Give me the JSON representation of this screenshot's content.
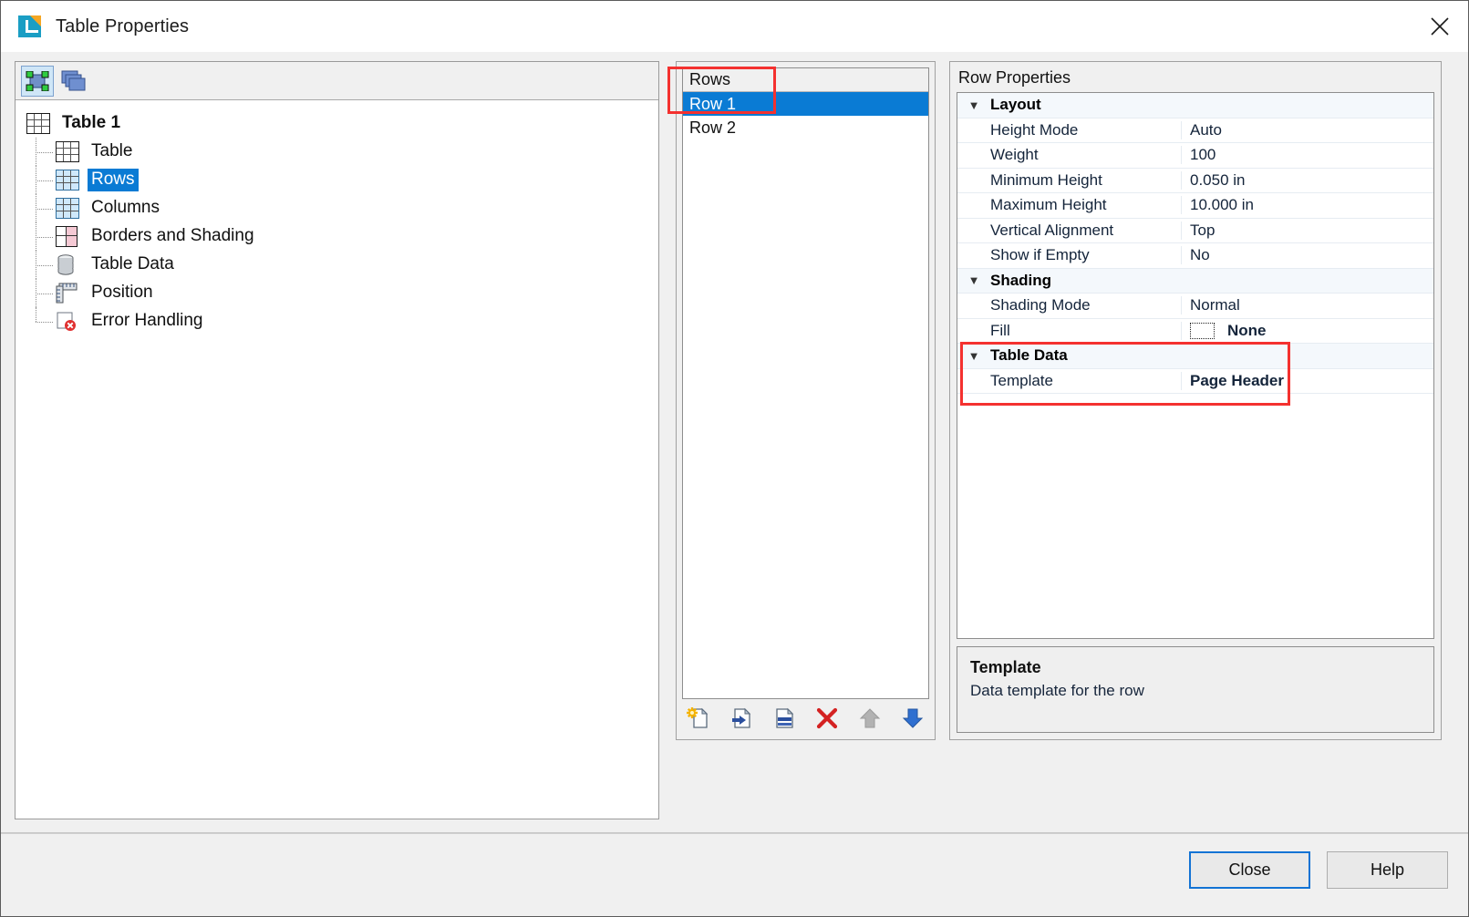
{
  "window": {
    "title": "Table Properties",
    "app_icon": "document-table-icon",
    "close_label": "×"
  },
  "left_panel": {
    "toolbar": [
      {
        "name": "selection-properties-button",
        "icon": "selection-handles-icon",
        "active": true
      },
      {
        "name": "all-objects-button",
        "icon": "stacked-windows-icon",
        "active": false
      }
    ],
    "tree": {
      "root": {
        "label": "Table 1",
        "icon": "table-grid-icon"
      },
      "children": [
        {
          "label": "Table",
          "icon": "table-grid-icon",
          "selected": false
        },
        {
          "label": "Rows",
          "icon": "table-rows-icon",
          "selected": true
        },
        {
          "label": "Columns",
          "icon": "table-columns-icon",
          "selected": false
        },
        {
          "label": "Borders and Shading",
          "icon": "borders-shading-icon",
          "selected": false
        },
        {
          "label": "Table Data",
          "icon": "database-icon",
          "selected": false
        },
        {
          "label": "Position",
          "icon": "ruler-position-icon",
          "selected": false
        },
        {
          "label": "Error Handling",
          "icon": "error-page-icon",
          "selected": false
        }
      ]
    }
  },
  "rows_panel": {
    "header": "Rows",
    "items": [
      {
        "label": "Row 1",
        "selected": true
      },
      {
        "label": "Row 2",
        "selected": false
      }
    ],
    "toolbar": [
      {
        "name": "new-row-button",
        "icon": "new-page-star-icon"
      },
      {
        "name": "insert-row-button",
        "icon": "page-arrow-in-icon"
      },
      {
        "name": "duplicate-row-button",
        "icon": "page-copy-icon"
      },
      {
        "name": "delete-row-button",
        "icon": "red-x-icon"
      },
      {
        "name": "move-row-up-button",
        "icon": "arrow-up-icon"
      },
      {
        "name": "move-row-down-button",
        "icon": "arrow-down-icon"
      }
    ]
  },
  "row_properties": {
    "title": "Row Properties",
    "groups": [
      {
        "name": "Layout",
        "expanded": true,
        "rows": [
          {
            "name": "Height Mode",
            "value": "Auto",
            "bold": false
          },
          {
            "name": "Weight",
            "value": "100",
            "bold": false
          },
          {
            "name": "Minimum Height",
            "value": "0.050 in",
            "bold": false
          },
          {
            "name": "Maximum Height",
            "value": "10.000 in",
            "bold": false
          },
          {
            "name": "Vertical Alignment",
            "value": "Top",
            "bold": false
          },
          {
            "name": "Show if Empty",
            "value": "No",
            "bold": false
          }
        ]
      },
      {
        "name": "Shading",
        "expanded": true,
        "rows": [
          {
            "name": "Shading Mode",
            "value": "Normal",
            "bold": false
          },
          {
            "name": "Fill",
            "value": "None",
            "bold": true,
            "swatch": "empty-fill-swatch"
          }
        ]
      },
      {
        "name": "Table Data",
        "expanded": true,
        "highlighted": true,
        "rows": [
          {
            "name": "Template",
            "value": "Page Header",
            "bold": true
          }
        ]
      }
    ],
    "description": {
      "title": "Template",
      "text": "Data template for the row"
    }
  },
  "footer": {
    "close_label": "Close",
    "help_label": "Help"
  },
  "annotations": {
    "highlight_color": "#f4312f",
    "boxes": [
      {
        "name": "rows-row1-highlight"
      },
      {
        "name": "table-data-template-highlight"
      }
    ]
  }
}
